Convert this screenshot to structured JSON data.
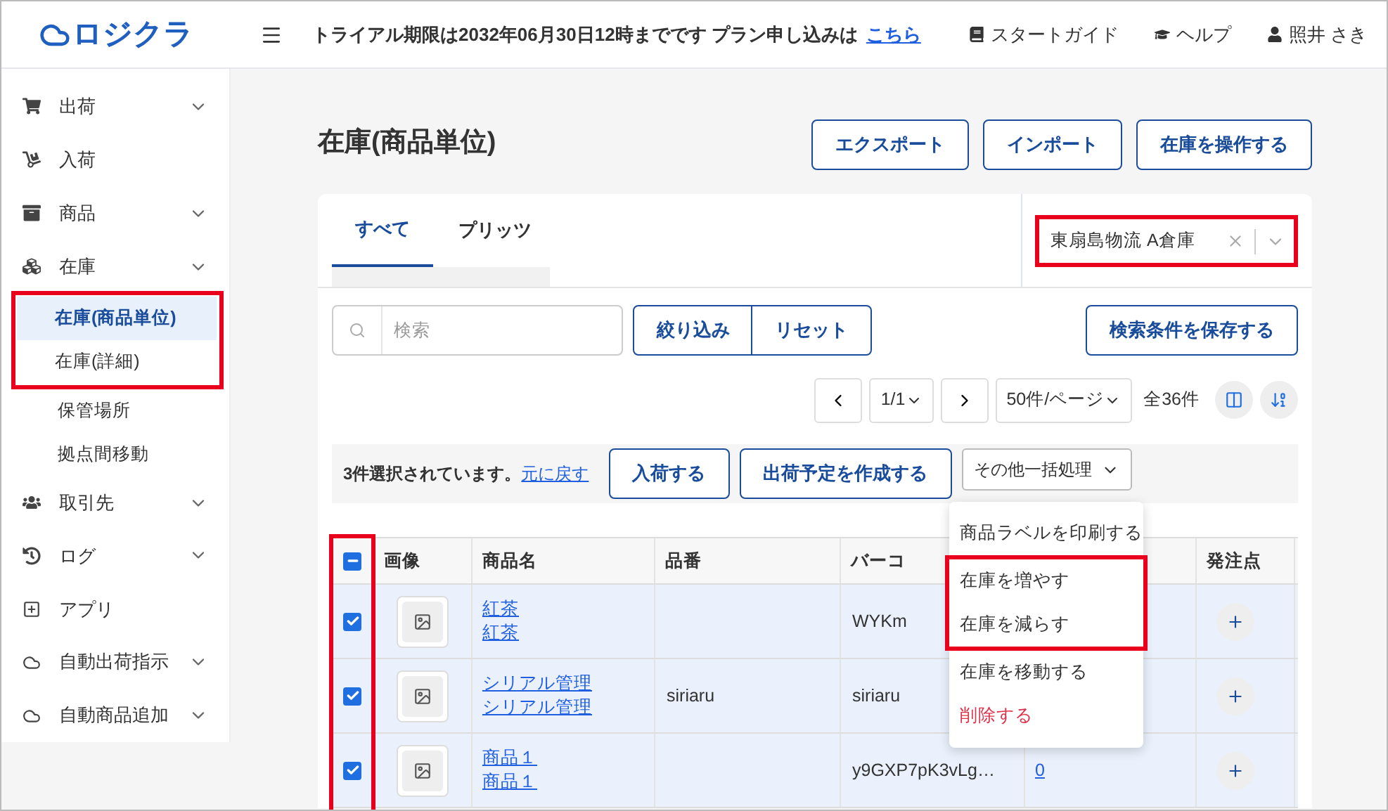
{
  "header": {
    "logo": "ロジクラ",
    "notice": "トライアル期限は2032年06月30日12時までです プラン申し込みは",
    "notice_link": "こちら",
    "links": [
      {
        "kind": "guide",
        "label": "スタートガイド"
      },
      {
        "kind": "help",
        "label": "ヘルプ"
      },
      {
        "kind": "user",
        "label": "照井 さき"
      }
    ]
  },
  "sidebar": {
    "items": [
      {
        "label": "出荷",
        "expandable": true
      },
      {
        "label": "入荷",
        "expandable": false
      },
      {
        "label": "商品",
        "expandable": true
      },
      {
        "label": "在庫",
        "expandable": true,
        "children": [
          {
            "label": "在庫(商品単位)",
            "selected": true,
            "highlighted": true
          },
          {
            "label": "在庫(詳細)",
            "selected": false,
            "highlighted": true
          },
          {
            "label": "保管場所",
            "selected": false,
            "highlighted": false
          },
          {
            "label": "拠点間移動",
            "selected": false,
            "highlighted": false
          }
        ]
      },
      {
        "label": "取引先",
        "expandable": true
      },
      {
        "label": "ログ",
        "expandable": true
      },
      {
        "label": "アプリ",
        "expandable": false
      },
      {
        "label": "自動出荷指示",
        "expandable": true
      },
      {
        "label": "自動商品追加",
        "expandable": true
      }
    ]
  },
  "page": {
    "title": "在庫(商品単位)",
    "actions": [
      "エクスポート",
      "インポート",
      "在庫を操作する"
    ]
  },
  "tabs": [
    {
      "label": "すべて",
      "selected": true
    },
    {
      "label": "プリッツ",
      "selected": false
    }
  ],
  "warehouse_select": {
    "value": "東扇島物流 A倉庫",
    "highlighted": true
  },
  "search": {
    "placeholder": "検索"
  },
  "filter_buttons": [
    "絞り込み",
    "リセット"
  ],
  "save_button": "検索条件を保存する",
  "pagination": {
    "page": "1/1",
    "per_page": "50件/ページ",
    "total": "全36件"
  },
  "bulk_bar": {
    "message": "3件選択されています。",
    "undo": "元に戻す",
    "buttons": [
      "入荷する",
      "出荷予定を作成する"
    ],
    "more": "その他一括処理"
  },
  "bulk_menu": {
    "items": [
      {
        "label": "商品ラベルを印刷する",
        "kind": "normal",
        "highlighted": false
      },
      {
        "label": "在庫を増やす",
        "kind": "normal",
        "highlighted": true
      },
      {
        "label": "在庫を減らす",
        "kind": "normal",
        "highlighted": true
      },
      {
        "label": "在庫を移動する",
        "kind": "normal",
        "highlighted": false
      },
      {
        "label": "削除する",
        "kind": "danger",
        "highlighted": false
      }
    ]
  },
  "table": {
    "select_all_indeterminate": true,
    "checkbox_column_highlighted": true,
    "columns": [
      "画像",
      "商品名",
      "品番",
      "バーコ",
      "発注点"
    ],
    "rows": [
      {
        "selected": true,
        "names": [
          "紅茶",
          "紅茶"
        ],
        "barcode": "WYKm"
      },
      {
        "selected": true,
        "names": [
          "シリアル管理",
          "シリアル管理"
        ],
        "code": "siriaru",
        "barcode": "siriaru"
      },
      {
        "selected": true,
        "names": [
          "商品１",
          "商品１"
        ],
        "barcode": "y9GXP7pK3vLg…",
        "column_5": "0"
      }
    ]
  }
}
